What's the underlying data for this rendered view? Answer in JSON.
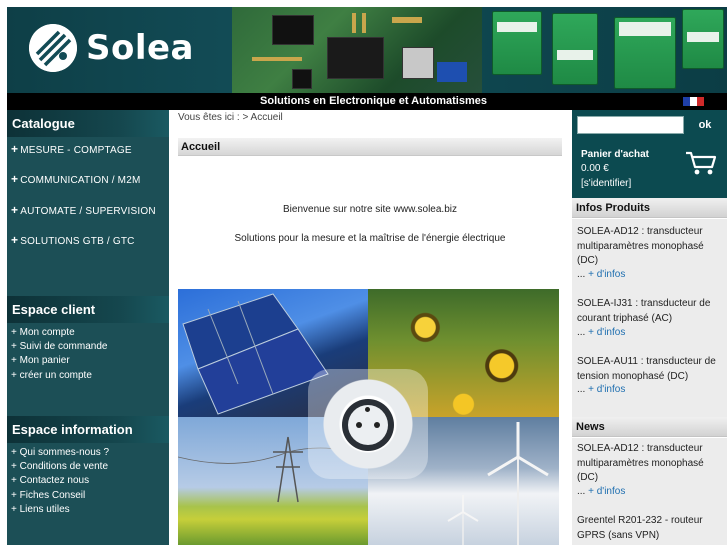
{
  "header": {
    "logo_text": "Solea",
    "nav_title": "Solutions en Electronique et Automatismes"
  },
  "colors": {
    "accent": "#1c4f56",
    "header_bg": "#0e3f47",
    "link": "#1f6fb0"
  },
  "left": {
    "catalogue": {
      "title": "Catalogue",
      "items": [
        {
          "label": "MESURE - COMPTAGE"
        },
        {
          "label": "COMMUNICATION / M2M"
        },
        {
          "label": "AUTOMATE / SUPERVISION"
        },
        {
          "label": "SOLUTIONS GTB / GTC"
        }
      ]
    },
    "espace_client": {
      "title": "Espace client",
      "items": [
        {
          "label": "+ Mon compte"
        },
        {
          "label": "+ Suivi de commande"
        },
        {
          "label": "+ Mon panier"
        },
        {
          "label": "+ créer un compte"
        }
      ]
    },
    "espace_information": {
      "title": "Espace information",
      "items": [
        {
          "label": "+ Qui sommes-nous ?"
        },
        {
          "label": "+ Conditions de vente"
        },
        {
          "label": "+ Contactez nous"
        },
        {
          "label": "+ Fiches Conseil"
        },
        {
          "label": "+ Liens utiles"
        }
      ]
    }
  },
  "center": {
    "breadcrumb": "Vous êtes ici : > Accueil",
    "heading": "Accueil",
    "welcome": "Bienvenue sur notre site www.solea.biz",
    "tagline": "Solutions pour la mesure et la maîtrise de l'énergie électrique"
  },
  "right": {
    "search": {
      "placeholder": "",
      "button": "ok"
    },
    "cart": {
      "title": "Panier d'achat",
      "amount": "0.00 €",
      "login": "[s'identifier]"
    },
    "infos_produits": {
      "title": "Infos Produits",
      "items": [
        {
          "text": "SOLEA-AD12 : transducteur multiparamètres monophasé (DC)",
          "more": "+ d'infos"
        },
        {
          "text": "SOLEA-IJ31 : transducteur de courant triphasé (AC)",
          "more": "+ d'infos"
        },
        {
          "text": "SOLEA-AU11 : transducteur de tension monophasé (DC)",
          "more": "+ d'infos"
        }
      ]
    },
    "news": {
      "title": "News",
      "items": [
        {
          "text": "SOLEA-AD12 : transducteur multiparamètres monophasé (DC)",
          "more": "+ d'infos"
        },
        {
          "text": "Greentel R201-232 - routeur GPRS (sans VPN)"
        }
      ]
    },
    "more_prefix": "..."
  },
  "icons": [
    "solea-logo-icon",
    "french-flag-icon",
    "cart-icon",
    "plus-icon"
  ]
}
